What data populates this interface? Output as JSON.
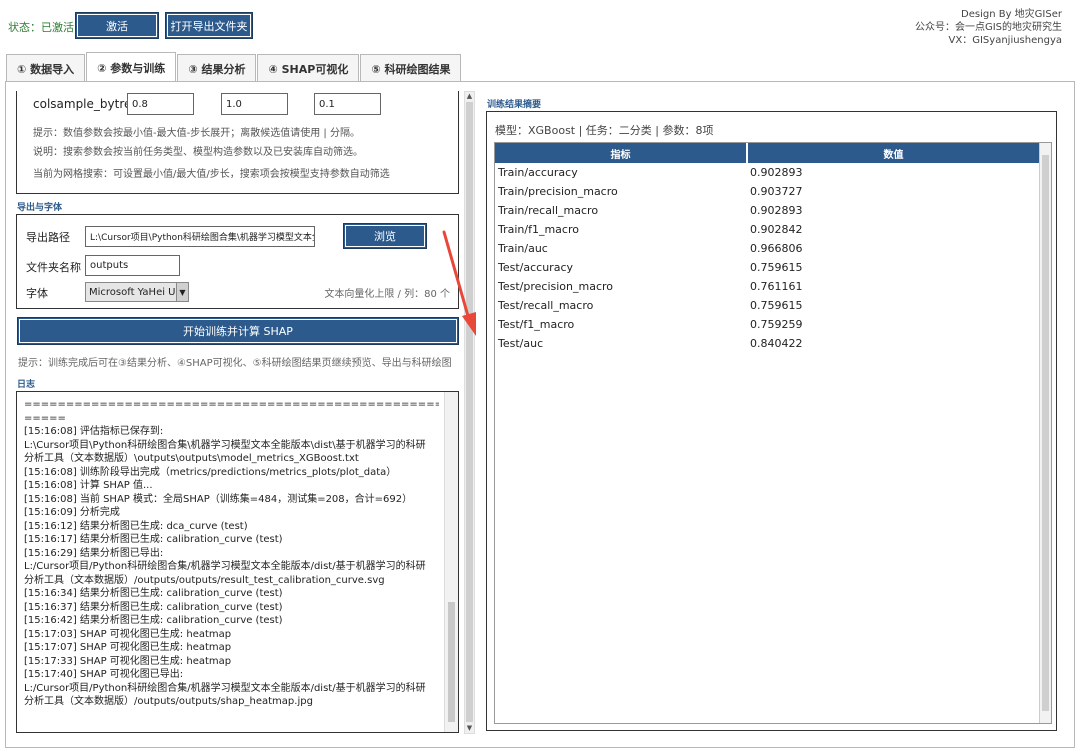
{
  "header": {
    "status": "状态：已激活",
    "activate_label": "激活",
    "open_folder_label": "打开导出文件夹",
    "credits": [
      "Design By 地灾GISer",
      "公众号：会一点GIS的地灾研究生",
      "VX：GISyanjiushengya"
    ]
  },
  "tabs": [
    {
      "label": "① 数据导入",
      "active": false
    },
    {
      "label": "② 参数与训练",
      "active": true
    },
    {
      "label": "③ 结果分析",
      "active": false
    },
    {
      "label": "④ SHAP可视化",
      "active": false
    },
    {
      "label": "⑤ 科研绘图结果",
      "active": false
    }
  ],
  "params": {
    "row_label": "colsample_bytree",
    "values": [
      "0.8",
      "1.0",
      "0.1"
    ],
    "hints": [
      "提示：数值参数会按最小值-最大值-步长展开；离散候选值请使用 | 分隔。",
      "说明：搜索参数会按当前任务类型、模型构造参数以及已安装库自动筛选。",
      "当前为网格搜索：可设置最小值/最大值/步长，搜索项会按模型支持参数自动筛选"
    ]
  },
  "export": {
    "section_title": "导出与字体",
    "path_label": "导出路径",
    "path_value": "L:\\Cursor项目\\Python科研绘图合集\\机器学习模型文本全能版",
    "browse_label": "浏览",
    "folder_label": "文件夹名称",
    "folder_value": "outputs",
    "font_label": "字体",
    "font_value": "Microsoft YaHei UI",
    "vec_hint": "文本向量化上限 / 列：80 个"
  },
  "train": {
    "button_label": "开始训练并计算 SHAP",
    "hint": "提示：训练完成后可在③结果分析、④SHAP可视化、⑤科研绘图结果页继续预览、导出与科研绘图"
  },
  "log": {
    "section_title": "日志",
    "lines": [
      "==========================================================",
      "=====",
      "[15:16:08] 评估指标已保存到:",
      "L:\\Cursor项目\\Python科研绘图合集\\机器学习模型文本全能版本\\dist\\基于机器学习的科研",
      "分析工具（文本数据版）\\outputs\\outputs\\model_metrics_XGBoost.txt",
      "[15:16:08] 训练阶段导出完成（metrics/predictions/metrics_plots/plot_data）",
      "[15:16:08] 计算 SHAP 值...",
      "[15:16:08] 当前 SHAP 模式：全局SHAP（训练集=484，测试集=208，合计=692）",
      "[15:16:09] 分析完成",
      "[15:16:12] 结果分析图已生成: dca_curve (test)",
      "[15:16:17] 结果分析图已生成: calibration_curve (test)",
      "[15:16:29] 结果分析图已导出:",
      "L:/Cursor项目/Python科研绘图合集/机器学习模型文本全能版本/dist/基于机器学习的科研",
      "分析工具（文本数据版）/outputs/outputs/result_test_calibration_curve.svg",
      "[15:16:34] 结果分析图已生成: calibration_curve (test)",
      "[15:16:37] 结果分析图已生成: calibration_curve (test)",
      "[15:16:42] 结果分析图已生成: calibration_curve (test)",
      "[15:17:03] SHAP 可视化图已生成: heatmap",
      "[15:17:07] SHAP 可视化图已生成: heatmap",
      "[15:17:33] SHAP 可视化图已生成: heatmap",
      "[15:17:40] SHAP 可视化图已导出:",
      "L:/Cursor项目/Python科研绘图合集/机器学习模型文本全能版本/dist/基于机器学习的科研",
      "分析工具（文本数据版）/outputs/outputs/shap_heatmap.jpg"
    ]
  },
  "results": {
    "section_title": "训练结果摘要",
    "summary": "模型：XGBoost | 任务：二分类 | 参数：8项",
    "columns": [
      "指标",
      "数值"
    ],
    "rows": [
      [
        "Train/accuracy",
        "0.902893"
      ],
      [
        "Train/precision_macro",
        "0.903727"
      ],
      [
        "Train/recall_macro",
        "0.902893"
      ],
      [
        "Train/f1_macro",
        "0.902842"
      ],
      [
        "Train/auc",
        "0.966806"
      ],
      [
        "Test/accuracy",
        "0.759615"
      ],
      [
        "Test/precision_macro",
        "0.761161"
      ],
      [
        "Test/recall_macro",
        "0.759615"
      ],
      [
        "Test/f1_macro",
        "0.759259"
      ],
      [
        "Test/auc",
        "0.840422"
      ]
    ]
  },
  "colors": {
    "accent": "#2d5a8c",
    "status_green": "#2e7d32",
    "annotation_red": "#e8473a"
  }
}
